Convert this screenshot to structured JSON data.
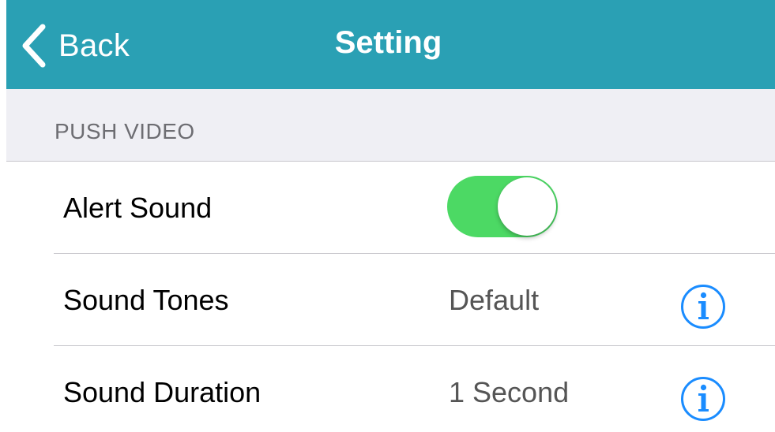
{
  "navbar": {
    "back_label": "Back",
    "title": "Setting",
    "background_color": "#2aa0b4",
    "back_icon": "chevron-left-icon"
  },
  "section": {
    "title": "PUSH VIDEO"
  },
  "rows": [
    {
      "label": "Alert Sound",
      "control": "toggle",
      "toggle_on": true
    },
    {
      "label": "Sound Tones",
      "value": "Default",
      "icon": "info-icon"
    },
    {
      "label": "Sound Duration",
      "value": "1 Second",
      "icon": "info-icon"
    }
  ],
  "colors": {
    "toggle_on": "#4cd964",
    "info_icon": "#1a8cff"
  }
}
